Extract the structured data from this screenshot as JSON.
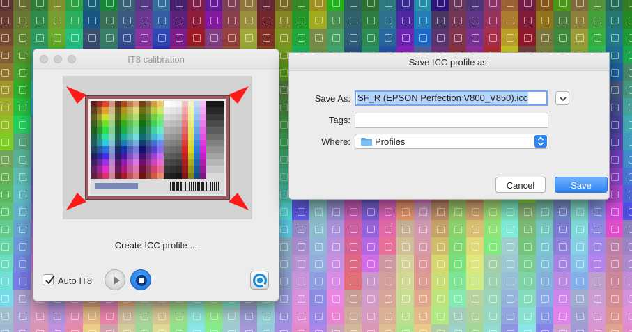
{
  "it8_window": {
    "title": "IT8 calibration",
    "status_label": "Create ICC profile ...",
    "auto_it8_label": "Auto IT8",
    "auto_it8_checked": true
  },
  "save_dialog": {
    "title": "Save ICC profile as:",
    "save_as_label": "Save As:",
    "save_as_value": "SF_R (EPSON Perfection V800_V850).icc",
    "tags_label": "Tags:",
    "tags_value": "",
    "where_label": "Where:",
    "where_value": "Profiles",
    "cancel_label": "Cancel",
    "save_label": "Save"
  },
  "colors": {
    "accent": "#2f86f2",
    "corner_arrow": "#ff1a1a"
  },
  "icons": {
    "play": "play-icon",
    "stop": "stop-icon",
    "app": "silverfast-icon",
    "folder": "folder-icon",
    "disclosure": "chevron-down-icon",
    "popup": "up-down-arrows-icon"
  }
}
